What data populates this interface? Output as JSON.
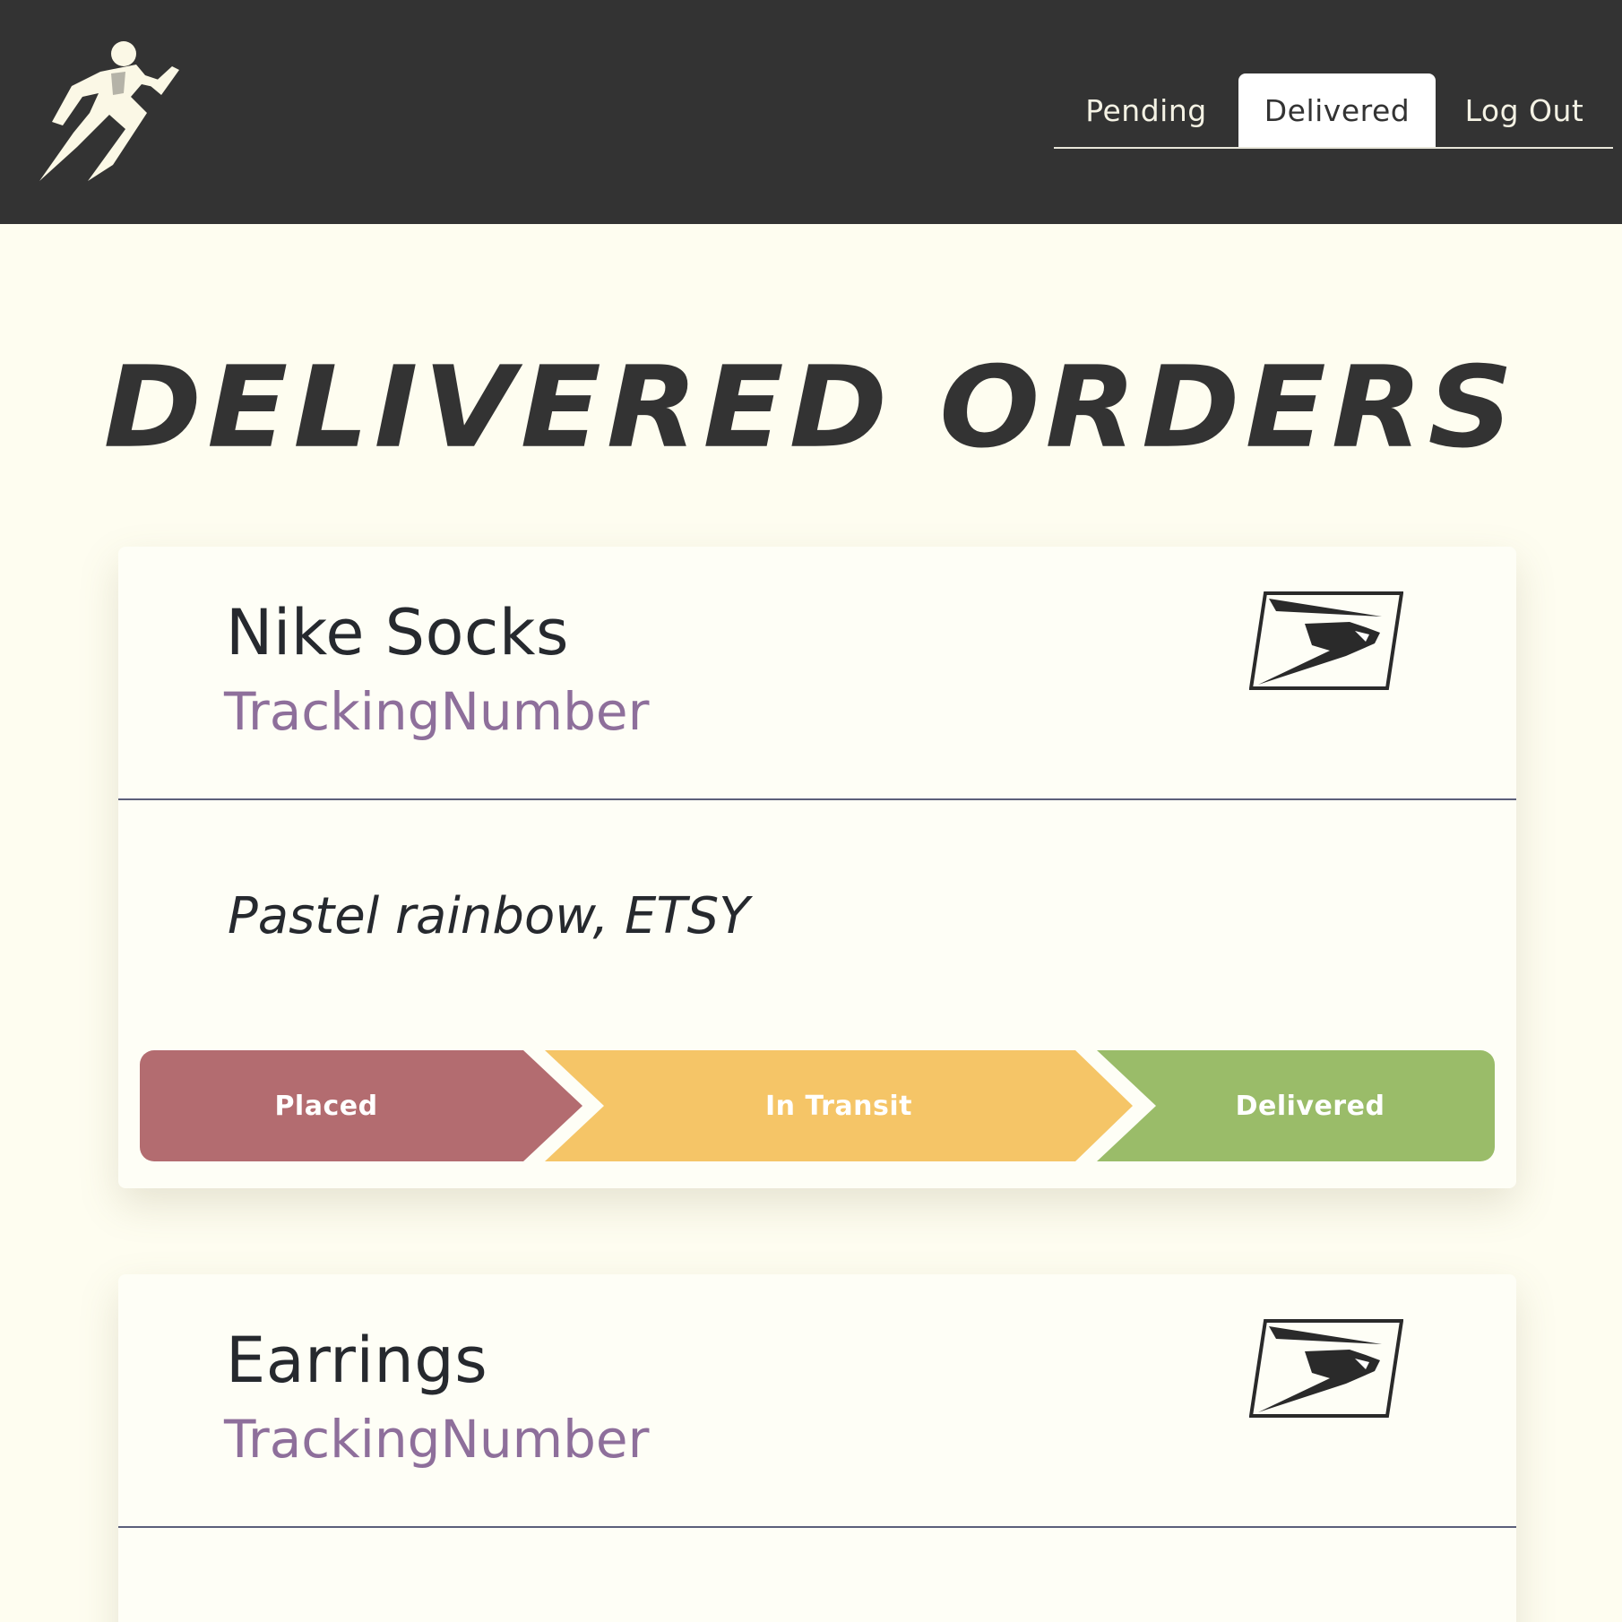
{
  "header": {
    "logo": "running-figure-logo",
    "nav": {
      "pending": "Pending",
      "delivered": "Delivered",
      "logout": "Log Out"
    }
  },
  "page": {
    "title": "DELIVERED ORDERS"
  },
  "orders": [
    {
      "name": "Nike Socks",
      "tracking": "TrackingNumber",
      "carrier_icon": "usps-eagle-icon",
      "description": "Pastel rainbow, ETSY",
      "steps": [
        "Placed",
        "In Transit",
        "Delivered"
      ]
    },
    {
      "name": "Earrings",
      "tracking": "TrackingNumber",
      "carrier_icon": "usps-eagle-icon"
    }
  ],
  "colors": {
    "topbar": "#333333",
    "background": "#fefdf0",
    "placed": "#b36c70",
    "in_transit": "#f5c567",
    "delivered": "#9abc69",
    "tracking_text": "#8e6f9b"
  }
}
